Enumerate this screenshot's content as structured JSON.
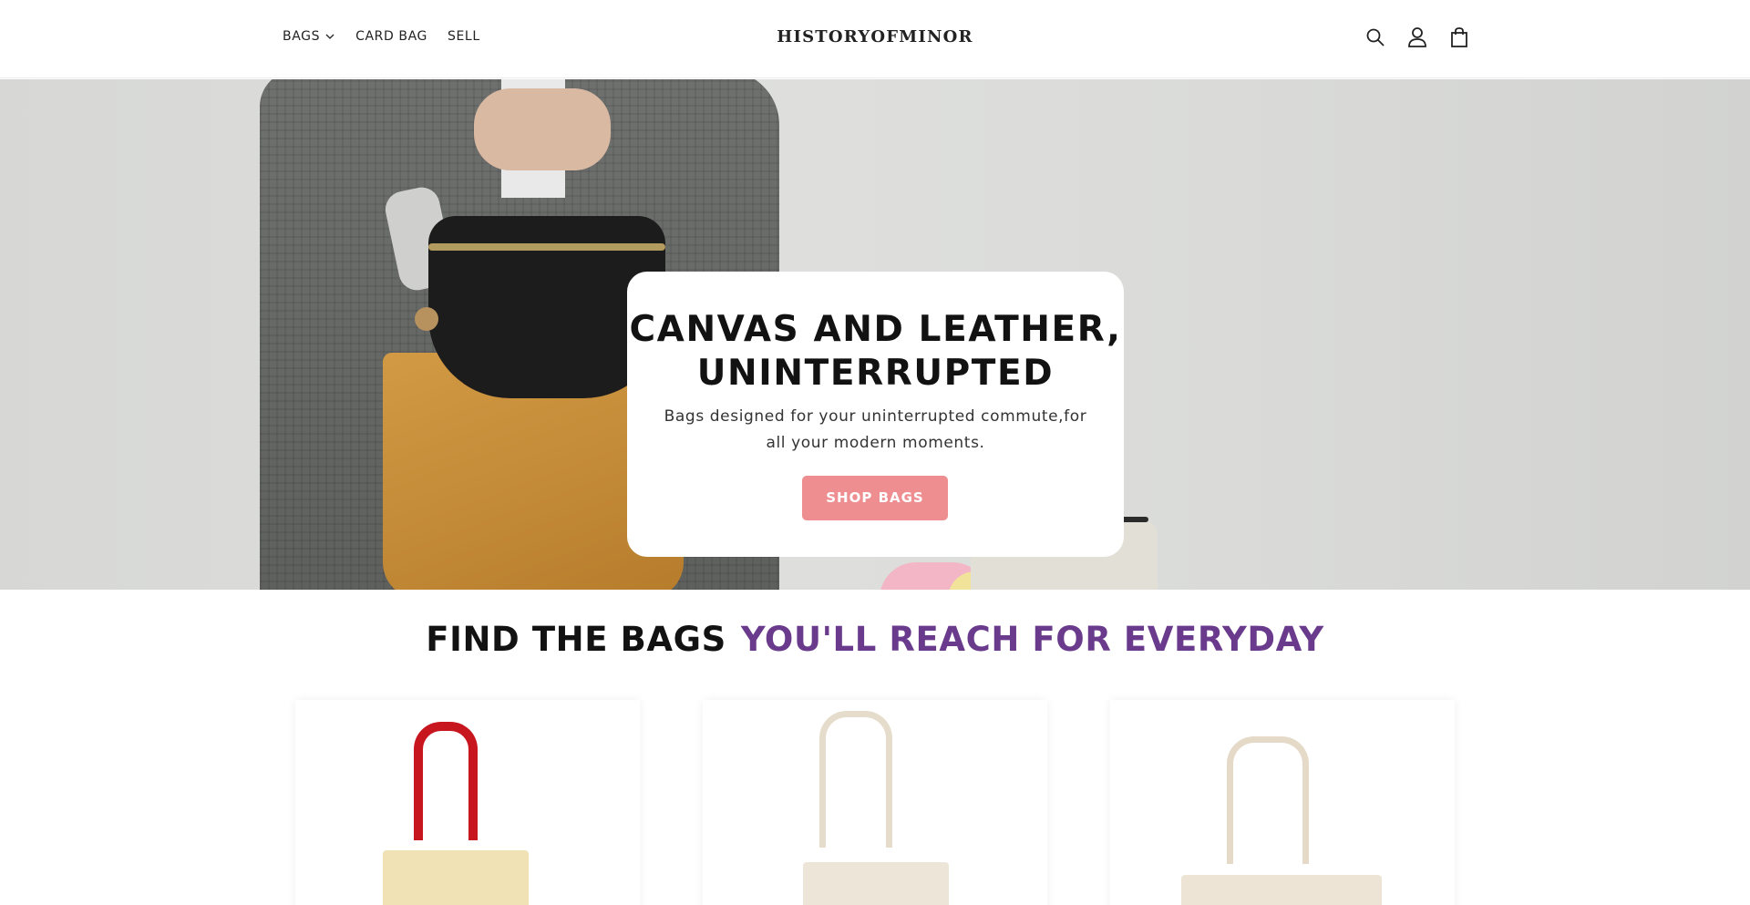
{
  "header": {
    "nav": [
      {
        "label": "BAGS",
        "has_dropdown": true
      },
      {
        "label": "CARD BAG"
      },
      {
        "label": "SELL"
      }
    ],
    "logo": "HISTORYOFMINOR",
    "icons": [
      "search-icon",
      "account-icon",
      "cart-icon"
    ]
  },
  "hero": {
    "title": "CANVAS AND LEATHER, UNINTERRUPTED",
    "subtitle": "Bags designed for your uninterrupted commute,for all your modern moments.",
    "button": "SHOP BAGS"
  },
  "section": {
    "title_part1": "FIND THE BAGS",
    "title_part2": "YOU'LL REACH FOR EVERYDAY"
  },
  "products": [
    {
      "image": "cream tote with red handles"
    },
    {
      "image": "natural canvas tote"
    },
    {
      "image": "natural canvas tote with zipper"
    }
  ],
  "colors": {
    "accent_button": "#ee8e90",
    "heading_purple": "#6a3b8c",
    "text_dark": "#121212"
  }
}
